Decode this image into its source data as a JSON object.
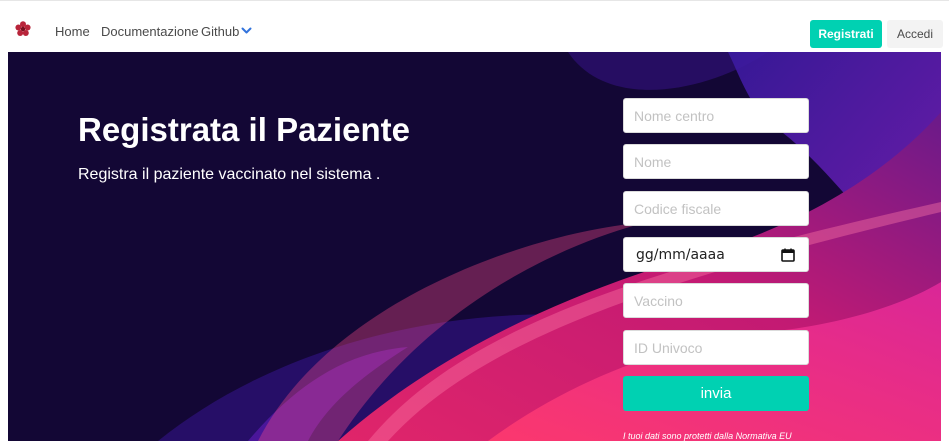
{
  "navbar": {
    "logo_icon": "flower-logo-icon",
    "links": [
      "Home",
      "Documentazione",
      "Github"
    ],
    "dropdown_icon": "chevron-down-icon",
    "register_label": "Registrati",
    "login_label": "Accedi"
  },
  "hero": {
    "title": "Registrata il Paziente",
    "subtitle": "Registra il paziente vaccinato nel sistema ."
  },
  "form": {
    "nome_centro_placeholder": "Nome centro",
    "nome_placeholder": "Nome",
    "codice_fiscale_placeholder": "Codice fiscale",
    "date_placeholder": "gg/mm/aaaa",
    "calendar_icon": "calendar-icon",
    "vaccino_placeholder": "Vaccino",
    "id_univoco_placeholder": "ID Univoco",
    "submit_label": "invia",
    "privacy_note": "I tuoi dati sono protetti dalla Normativa EU"
  },
  "colors": {
    "accent": "#00d1b2",
    "hero_background": "#130735",
    "logo": "#b8243a"
  }
}
